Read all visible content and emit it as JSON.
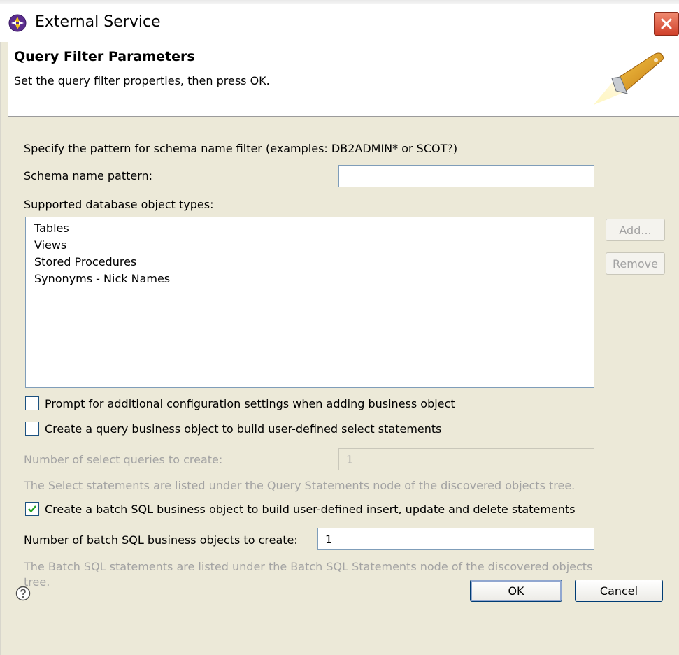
{
  "window": {
    "title": "External Service"
  },
  "banner": {
    "title": "Query Filter Parameters",
    "description": "Set the query filter properties, then press OK."
  },
  "form": {
    "schema_hint": "Specify the pattern for schema name filter (examples: DB2ADMIN* or SCOT?)",
    "schema_label": "Schema name pattern:",
    "schema_value": "",
    "object_types_label": "Supported database object types:",
    "object_types": [
      "Tables",
      "Views",
      "Stored Procedures",
      "Synonyms - Nick Names"
    ],
    "add_button": "Add...",
    "remove_button": "Remove",
    "prompt_checkbox": {
      "label": "Prompt for additional configuration settings when adding business object",
      "checked": false
    },
    "query_checkbox": {
      "label": "Create a query business object to build user-defined select statements",
      "checked": false
    },
    "select_queries_label": "Number of select queries to create:",
    "select_queries_value": "1",
    "select_note": "The Select statements are listed under the Query Statements node of the discovered objects tree.",
    "batch_checkbox": {
      "label": "Create a batch SQL business object to build user-defined insert, update and delete statements",
      "checked": true
    },
    "batch_count_label": "Number of batch SQL business objects to create:",
    "batch_count_value": "1",
    "batch_note_line1": "The Batch SQL statements are listed under the Batch SQL Statements node of the discovered objects",
    "batch_note_line2": "tree."
  },
  "footer": {
    "ok": "OK",
    "cancel": "Cancel"
  },
  "colors": {
    "dialog_bg": "#ece9d8",
    "disabled_text": "#a3a3a3",
    "checkbox_check": "#21a121"
  },
  "icons": [
    "app-icon",
    "close-icon",
    "flashlight-icon",
    "help-icon",
    "checkmark-icon"
  ]
}
